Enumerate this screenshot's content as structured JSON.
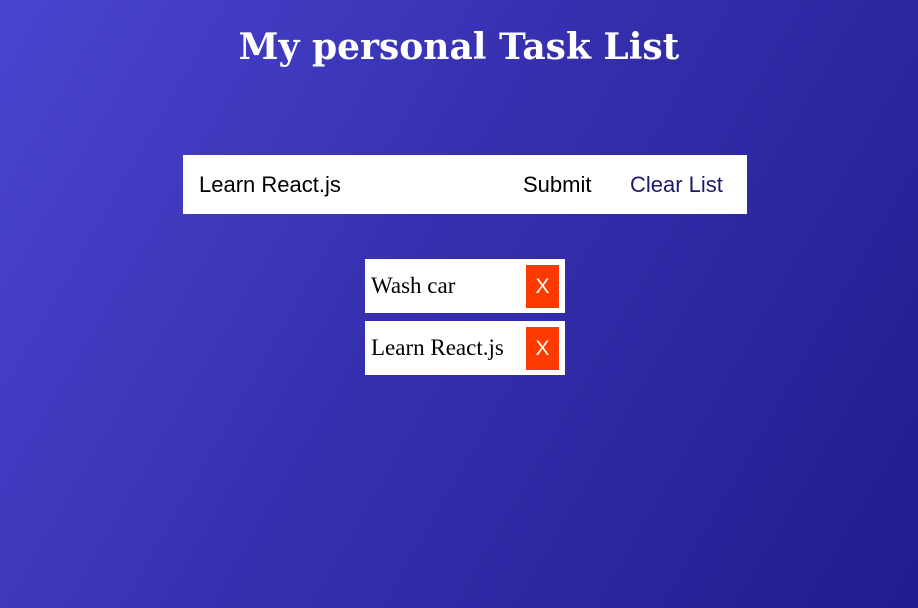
{
  "header": {
    "title": "My personal Task List"
  },
  "form": {
    "input_value": "Learn React.js",
    "submit_label": "Submit",
    "clear_label": "Clear List"
  },
  "tasks": [
    {
      "text": "Wash car",
      "delete_label": "X"
    },
    {
      "text": "Learn React.js",
      "delete_label": "X"
    }
  ],
  "colors": {
    "delete_button": "#ff3a00",
    "clear_link": "#1b1a6a",
    "background_start": "#4a45cf",
    "background_end": "#211c8e"
  }
}
